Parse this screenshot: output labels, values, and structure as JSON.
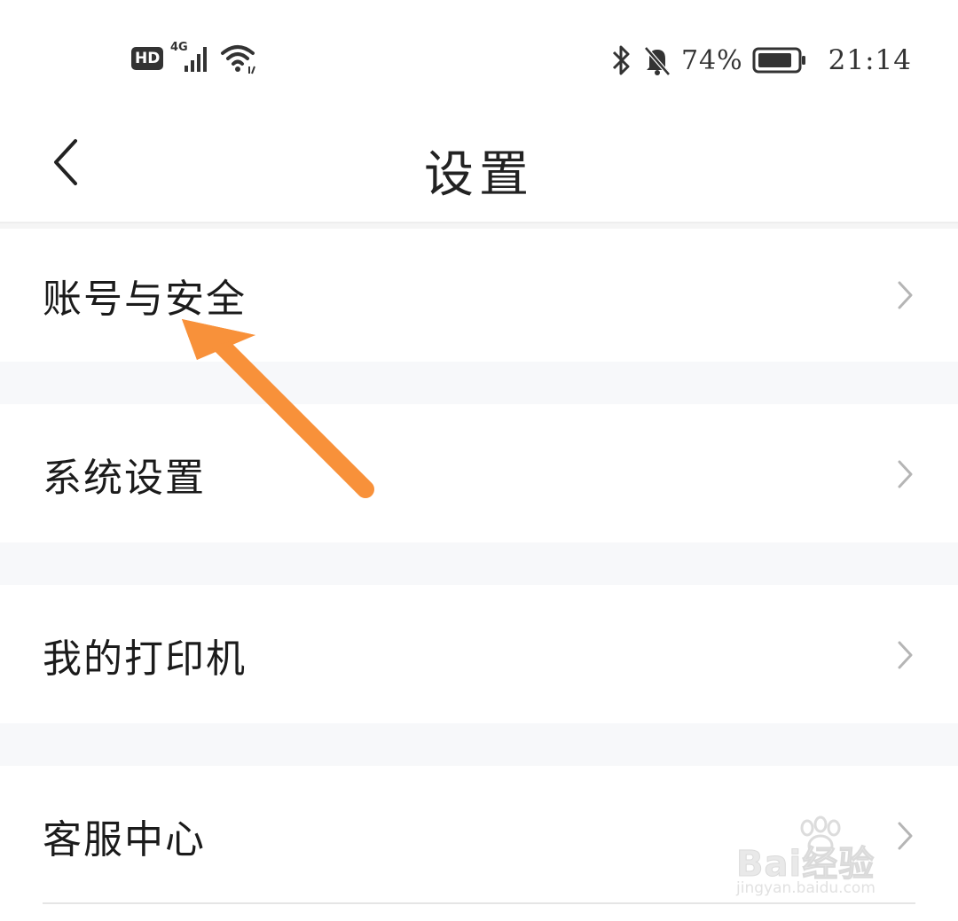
{
  "status_bar": {
    "hd_label": "HD",
    "network_label": "4G",
    "battery_percent": "74%",
    "time": "21:14",
    "icons": [
      "signal-icon",
      "wifi-icon",
      "bluetooth-icon",
      "bell-muted-icon",
      "battery-icon"
    ]
  },
  "header": {
    "title": "设置",
    "back_icon": "chevron-left-icon"
  },
  "menu": {
    "items": [
      {
        "label": "账号与安全",
        "icon": "chevron-right-icon"
      },
      {
        "label": "系统设置",
        "icon": "chevron-right-icon"
      },
      {
        "label": "我的打印机",
        "icon": "chevron-right-icon"
      },
      {
        "label": "客服中心",
        "icon": "chevron-right-icon"
      }
    ]
  },
  "annotation": {
    "arrow_color": "#f8913a"
  },
  "watermark": {
    "brand": "Bai经验",
    "url": "jingyan.baidu.com"
  },
  "colors": {
    "background": "#ffffff",
    "separator": "#f7f8fa",
    "text": "#1b1b1b",
    "chevron": "#b5b5b5"
  }
}
